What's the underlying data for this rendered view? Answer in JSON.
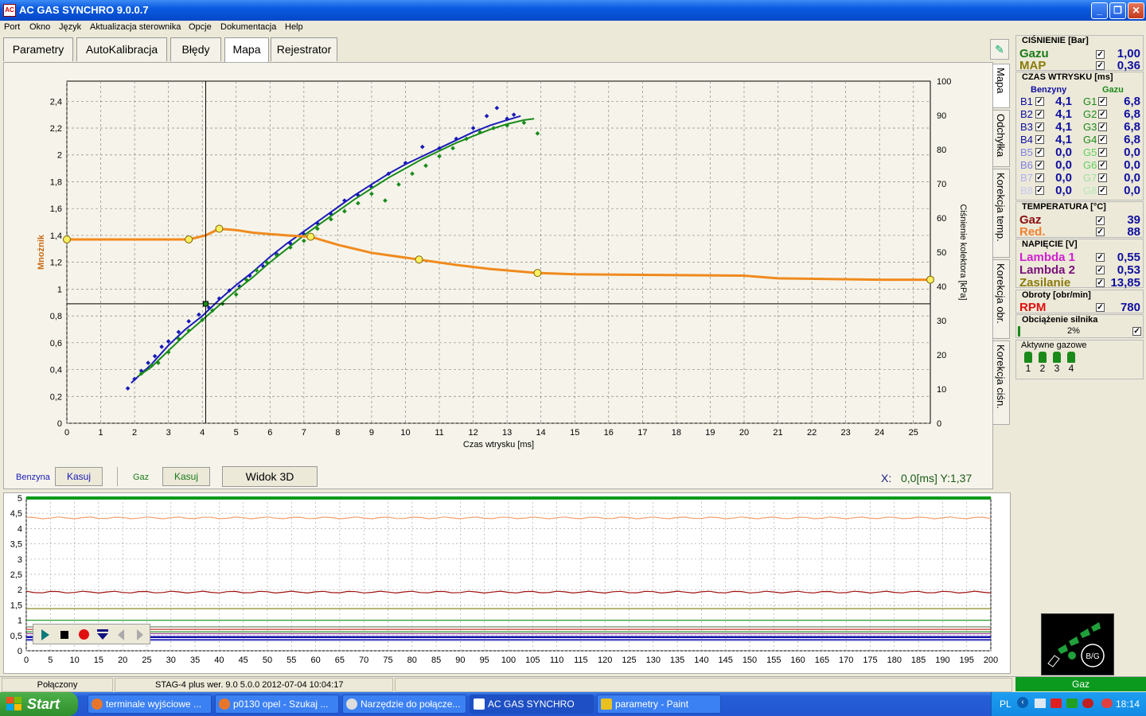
{
  "window": {
    "title": "AC GAS SYNCHRO  9.0.0.7",
    "app_icon": "ac-logo-icon",
    "min": "_",
    "max": "❐",
    "close": "✕"
  },
  "menu": [
    "Port",
    "Okno",
    "Język",
    "Aktualizacja sterownika",
    "Opcje",
    "Dokumentacja",
    "Help"
  ],
  "tabs": [
    "Parametry",
    "AutoKalibracja",
    "Błędy",
    "Mapa",
    "Rejestrator"
  ],
  "active_tab": "Mapa",
  "side_tabs": [
    "Mapa",
    "Odchyłka",
    "Korekcja temp.",
    "Korekcja obr.",
    "Korekcja ciśn."
  ],
  "map": {
    "benzyna_label": "Benzyna",
    "gaz_label": "Gaz",
    "kasuj_label": "Kasuj",
    "view3d_label": "Widok 3D",
    "coords_label": "X:",
    "coords_value": "0,0[ms] Y:1,37"
  },
  "status": {
    "connected": "Połączony",
    "device": "STAG-4 plus   wer. 9.0  5.0.0    2012-07-04 10:04:17",
    "fuel": "Gaz"
  },
  "right": {
    "pressure_title": "CIŚNIENIE [Bar]",
    "pressure_rows": [
      {
        "label": "Gazu",
        "value": "1,00",
        "color": "#1a7a1a"
      },
      {
        "label": "MAP",
        "value": "0,36",
        "color": "#8a7a0a"
      }
    ],
    "inj_title": "CZAS WTRYSKU [ms]",
    "inj_benz_header": "Benzyny",
    "inj_gaz_header": "Gazu",
    "inj_rows": [
      {
        "b": "B1",
        "bv": "4,1",
        "g": "G1",
        "gv": "6,8"
      },
      {
        "b": "B2",
        "bv": "4,1",
        "g": "G2",
        "gv": "6,8"
      },
      {
        "b": "B3",
        "bv": "4,1",
        "g": "G3",
        "gv": "6,8"
      },
      {
        "b": "B4",
        "bv": "4,1",
        "g": "G4",
        "gv": "6,8"
      },
      {
        "b": "B5",
        "bv": "0,0",
        "g": "G5",
        "gv": "0,0"
      },
      {
        "b": "B6",
        "bv": "0,0",
        "g": "G6",
        "gv": "0,0"
      },
      {
        "b": "B7",
        "bv": "0,0",
        "g": "G7",
        "gv": "0,0"
      },
      {
        "b": "B8",
        "bv": "0,0",
        "g": "G8",
        "gv": "0,0"
      }
    ],
    "temp_title": "TEMPERATURA  [°C]",
    "temp_rows": [
      {
        "label": "Gaz",
        "value": "39",
        "color": "#8a1010"
      },
      {
        "label": "Red.",
        "value": "88",
        "color": "#f08030"
      }
    ],
    "volt_title": "NAPIĘCIE [V]",
    "volt_rows": [
      {
        "label": "Lambda 1",
        "value": "0,55",
        "color": "#d020d0"
      },
      {
        "label": "Lambda 2",
        "value": "0,53",
        "color": "#7a107a"
      },
      {
        "label": "Zasilanie",
        "value": "13,85",
        "color": "#8a7a0a"
      }
    ],
    "rpm_title": "Obroty [obr/min]",
    "rpm_label": "RPM",
    "rpm_value": "780",
    "load_title": "Obciążenie silnika",
    "load_value": "2%",
    "load_fraction": 0.02,
    "active_injectors_title": "Aktywne gazowe",
    "active_injectors": [
      "1",
      "2",
      "3",
      "4"
    ],
    "check_mark": "✓",
    "logo_text": "B/G"
  },
  "taskbar": {
    "start": "Start",
    "tasks": [
      "terminale wyjściowe ...",
      "p0130 opel - Szukaj ...",
      "Narzędzie do połącze...",
      "AC GAS SYNCHRO",
      "parametry - Paint"
    ],
    "lang": "PL",
    "clock": "18:14"
  },
  "chart_data": [
    {
      "type": "scatter",
      "xlabel": "Czas wtrysku [ms]",
      "ylabel": "Mnożnik",
      "y2label": "Ciśnienie kolektora [kPa]",
      "xlim": [
        0,
        25.5
      ],
      "ylim": [
        0,
        2.55
      ],
      "y2lim": [
        0,
        100
      ],
      "x_ticks": [
        0,
        1,
        2,
        3,
        4,
        5,
        6,
        7,
        8,
        9,
        10,
        11,
        12,
        13,
        14,
        15,
        16,
        17,
        18,
        19,
        20,
        21,
        22,
        23,
        24,
        25
      ],
      "y_ticks": [
        "0",
        "0,2",
        "0,4",
        "0,6",
        "0,8",
        "1",
        "1,2",
        "1,4",
        "1,6",
        "1,8",
        "2",
        "2,2",
        "2,4"
      ],
      "y2_ticks": [
        "0",
        "10",
        "20",
        "30",
        "40",
        "50",
        "60",
        "70",
        "80",
        "90",
        "100"
      ],
      "grid": true,
      "cursor": {
        "x": 4.1,
        "y": 0.89
      },
      "series": [
        {
          "name": "Benzyna",
          "color": "#1a1ab8",
          "curve": [
            [
              1.9,
              0.3
            ],
            [
              2.5,
              0.44
            ],
            [
              3,
              0.58
            ],
            [
              3.5,
              0.7
            ],
            [
              4,
              0.8
            ],
            [
              4.5,
              0.92
            ],
            [
              5,
              1.03
            ],
            [
              5.5,
              1.13
            ],
            [
              6,
              1.24
            ],
            [
              6.5,
              1.34
            ],
            [
              7,
              1.43
            ],
            [
              7.5,
              1.52
            ],
            [
              8,
              1.61
            ],
            [
              8.5,
              1.7
            ],
            [
              9,
              1.78
            ],
            [
              9.5,
              1.86
            ],
            [
              10,
              1.93
            ],
            [
              10.5,
              1.99
            ],
            [
              11,
              2.05
            ],
            [
              11.5,
              2.11
            ],
            [
              12,
              2.17
            ],
            [
              12.5,
              2.22
            ],
            [
              13,
              2.26
            ],
            [
              13.4,
              2.29
            ]
          ],
          "points": [
            [
              1.8,
              0.26
            ],
            [
              2,
              0.33
            ],
            [
              2.2,
              0.39
            ],
            [
              2.4,
              0.45
            ],
            [
              2.6,
              0.5
            ],
            [
              2.8,
              0.57
            ],
            [
              3,
              0.61
            ],
            [
              3.3,
              0.68
            ],
            [
              3.6,
              0.76
            ],
            [
              3.9,
              0.81
            ],
            [
              4.2,
              0.86
            ],
            [
              4.5,
              0.93
            ],
            [
              4.8,
              0.99
            ],
            [
              5.1,
              1.02
            ],
            [
              5.4,
              1.1
            ],
            [
              5.8,
              1.17
            ],
            [
              6.2,
              1.26
            ],
            [
              6.6,
              1.34
            ],
            [
              7,
              1.41
            ],
            [
              7.4,
              1.49
            ],
            [
              7.8,
              1.56
            ],
            [
              8.2,
              1.66
            ],
            [
              8.6,
              1.7
            ],
            [
              9,
              1.76
            ],
            [
              9.5,
              1.86
            ],
            [
              10,
              1.94
            ],
            [
              10.5,
              2.06
            ],
            [
              11,
              2.05
            ],
            [
              11.5,
              2.12
            ],
            [
              12,
              2.2
            ],
            [
              12.4,
              2.29
            ],
            [
              12.7,
              2.35
            ],
            [
              13,
              2.27
            ],
            [
              13.2,
              2.3
            ]
          ]
        },
        {
          "name": "Gaz",
          "color": "#1a8a1a",
          "curve": [
            [
              2.1,
              0.35
            ],
            [
              2.5,
              0.42
            ],
            [
              3,
              0.54
            ],
            [
              3.5,
              0.66
            ],
            [
              4,
              0.77
            ],
            [
              4.5,
              0.88
            ],
            [
              5,
              0.99
            ],
            [
              5.5,
              1.09
            ],
            [
              6,
              1.2
            ],
            [
              6.5,
              1.3
            ],
            [
              7,
              1.4
            ],
            [
              7.5,
              1.49
            ],
            [
              8,
              1.58
            ],
            [
              8.5,
              1.67
            ],
            [
              9,
              1.75
            ],
            [
              9.5,
              1.83
            ],
            [
              10,
              1.9
            ],
            [
              10.5,
              1.97
            ],
            [
              11,
              2.03
            ],
            [
              11.5,
              2.09
            ],
            [
              12,
              2.14
            ],
            [
              12.5,
              2.19
            ],
            [
              13,
              2.23
            ],
            [
              13.5,
              2.26
            ],
            [
              13.8,
              2.27
            ]
          ],
          "points": [
            [
              2.2,
              0.37
            ],
            [
              2.5,
              0.43
            ],
            [
              2.7,
              0.45
            ],
            [
              3,
              0.53
            ],
            [
              3.3,
              0.63
            ],
            [
              3.6,
              0.69
            ],
            [
              4,
              0.77
            ],
            [
              4.3,
              0.84
            ],
            [
              4.6,
              0.89
            ],
            [
              5,
              0.96
            ],
            [
              5.3,
              1.07
            ],
            [
              5.6,
              1.14
            ],
            [
              5.9,
              1.2
            ],
            [
              6.2,
              1.25
            ],
            [
              6.6,
              1.31
            ],
            [
              7,
              1.36
            ],
            [
              7.4,
              1.45
            ],
            [
              7.8,
              1.52
            ],
            [
              8.2,
              1.58
            ],
            [
              8.6,
              1.64
            ],
            [
              9,
              1.71
            ],
            [
              9.4,
              1.66
            ],
            [
              9.8,
              1.78
            ],
            [
              10.2,
              1.86
            ],
            [
              10.6,
              1.92
            ],
            [
              11,
              1.99
            ],
            [
              11.4,
              2.05
            ],
            [
              11.8,
              2.12
            ],
            [
              12.2,
              2.17
            ],
            [
              12.6,
              2.2
            ],
            [
              13,
              2.22
            ],
            [
              13.5,
              2.24
            ],
            [
              13.9,
              2.16
            ]
          ]
        },
        {
          "name": "Mnożnik",
          "color": "#f08a1e",
          "curve": [
            [
              0,
              1.37
            ],
            [
              3.6,
              1.37
            ],
            [
              4.1,
              1.4
            ],
            [
              4.5,
              1.45
            ],
            [
              5,
              1.44
            ],
            [
              5.5,
              1.42
            ],
            [
              6,
              1.41
            ],
            [
              6.5,
              1.4
            ],
            [
              7.2,
              1.39
            ],
            [
              8,
              1.33
            ],
            [
              9,
              1.27
            ],
            [
              10.4,
              1.22
            ],
            [
              11.5,
              1.18
            ],
            [
              12.5,
              1.15
            ],
            [
              13.9,
              1.12
            ],
            [
              15,
              1.11
            ],
            [
              20,
              1.1
            ],
            [
              21,
              1.08
            ],
            [
              24,
              1.07
            ],
            [
              25.5,
              1.07
            ]
          ],
          "points": [
            [
              0,
              1.37
            ],
            [
              3.6,
              1.37
            ],
            [
              4.5,
              1.45
            ],
            [
              7.2,
              1.39
            ],
            [
              10.4,
              1.22
            ],
            [
              13.9,
              1.12
            ],
            [
              25.5,
              1.07
            ]
          ]
        }
      ]
    },
    {
      "type": "line",
      "xlim": [
        0,
        200
      ],
      "ylim": [
        0,
        5
      ],
      "x_ticks": [
        0,
        5,
        10,
        15,
        20,
        25,
        30,
        35,
        40,
        45,
        50,
        55,
        60,
        65,
        70,
        75,
        80,
        85,
        90,
        95,
        100,
        105,
        110,
        115,
        120,
        125,
        130,
        135,
        140,
        145,
        150,
        155,
        160,
        165,
        170,
        175,
        180,
        185,
        190,
        195,
        200
      ],
      "y_ticks": [
        "0",
        "0,5",
        "1",
        "1,5",
        "2",
        "2,5",
        "3",
        "3,5",
        "4",
        "4,5",
        "5"
      ],
      "grid": true,
      "series": [
        {
          "color": "#0a9a1a",
          "value": 5.0
        },
        {
          "color": "#f0a070",
          "value": 4.35
        },
        {
          "color": "#a01010",
          "value": 1.92
        },
        {
          "color": "#8a8a2a",
          "value": 1.38
        },
        {
          "color": "#2a9a2a",
          "value": 1.0
        },
        {
          "color": "#6a8a6a",
          "value": 0.78
        },
        {
          "color": "#c83030",
          "value": 0.7
        },
        {
          "color": "#0a8a0a",
          "value": 0.62
        },
        {
          "color": "#a040a0",
          "value": 0.56
        },
        {
          "color": "#1010b0",
          "value": 0.45
        },
        {
          "color": "#5050c0",
          "value": 0.36
        }
      ]
    }
  ]
}
